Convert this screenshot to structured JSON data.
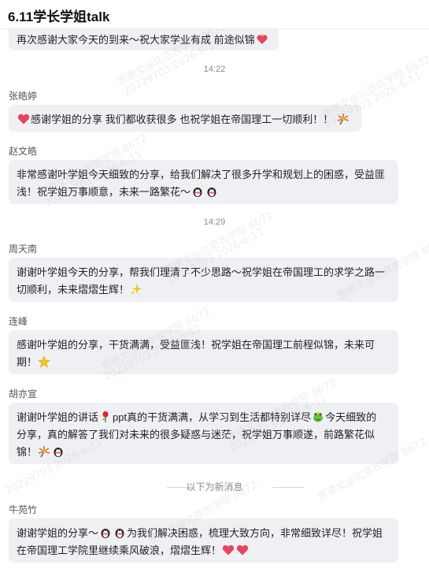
{
  "header": {
    "title": "6.11学长学姐talk"
  },
  "messages": [
    {
      "name": "",
      "text": "再次感谢大家今天的到来～祝大家学业有成 前途似锦"
    },
    {
      "time": "14:22"
    },
    {
      "name": "张皓婷",
      "text": "感谢学姐的分享 我们都收获很多 也祝学姐在帝国理工一切顺利！！"
    },
    {
      "name": "赵文皓",
      "text_line1": "非常感谢叶学姐今天细致的分享，给我们解决了很多升学和规划上的困惑，受益匪",
      "text_line2": "浅！祝学姐万事顺意，未来一路繁花～"
    },
    {
      "time": "14:29"
    },
    {
      "name": "周天南",
      "text_line1": "谢谢叶学姐今天的分享，帮我们理清了不少思路～祝学姐在帝国理工的求学之路一",
      "text_line2": "切顺利，未来熠熠生辉！"
    },
    {
      "name": "连峰",
      "text_line1": "感谢叶学姐的分享，干货满满，受益匪浅！祝学姐在帝国理工前程似锦，未来可",
      "text_line2": "期！"
    },
    {
      "name": "胡亦宣",
      "text_line1a": "谢谢叶学姐的讲话",
      "text_line1b": "ppt真的干货满满，从学习到生活都特别详尽",
      "text_line1c": "今天细致的",
      "text_line2": "分享，真的解答了我们对未来的很多疑惑与迷茫，祝学姐万事顺遂，前路繁花似",
      "text_line3": "锦！"
    },
    {
      "name": "牛苑竹",
      "text_line1a": "谢谢学姐的分享～",
      "text_line1b": "为我们解决困惑，梳理大致方向，非常细致详尽！祝学姐",
      "text_line2": "在帝国理工学院里继续乘风破浪，熠熠生辉！"
    }
  ],
  "divider": {
    "label": "以下为新消息"
  },
  "watermark": [
    "贾德文@北京农学院 8672",
    "20229703 2026-6-11"
  ],
  "colors": {
    "bubble": "#eef0f3",
    "heart": "#e8455e",
    "star": "#f5c518",
    "firework": "#e36a2a"
  },
  "icons": [
    "heart-icon",
    "fireworks-icon",
    "penguin-icon",
    "sparkles-icon",
    "star-icon",
    "rose-icon",
    "frog-icon"
  ]
}
